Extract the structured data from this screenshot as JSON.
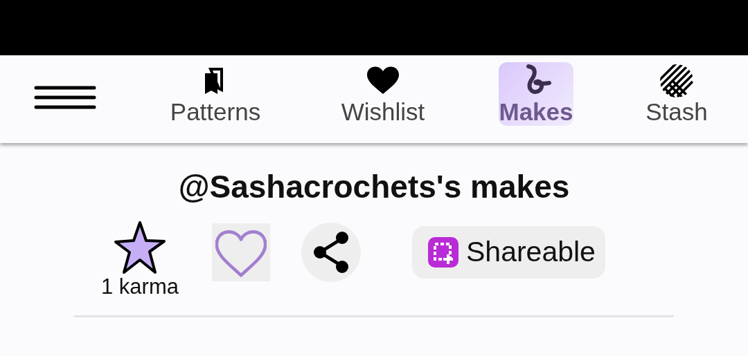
{
  "nav_tabs": [
    {
      "kind": "patterns",
      "label": "Patterns",
      "selected": false
    },
    {
      "kind": "wishlist",
      "label": "Wishlist",
      "selected": false
    },
    {
      "kind": "makes",
      "label": "Makes",
      "selected": true
    },
    {
      "kind": "stash",
      "label": "Stash",
      "selected": false
    }
  ],
  "page_title": "@Sashacrochets's makes",
  "karma": "1 karma",
  "liked": false,
  "shareable_button": "Shareable"
}
